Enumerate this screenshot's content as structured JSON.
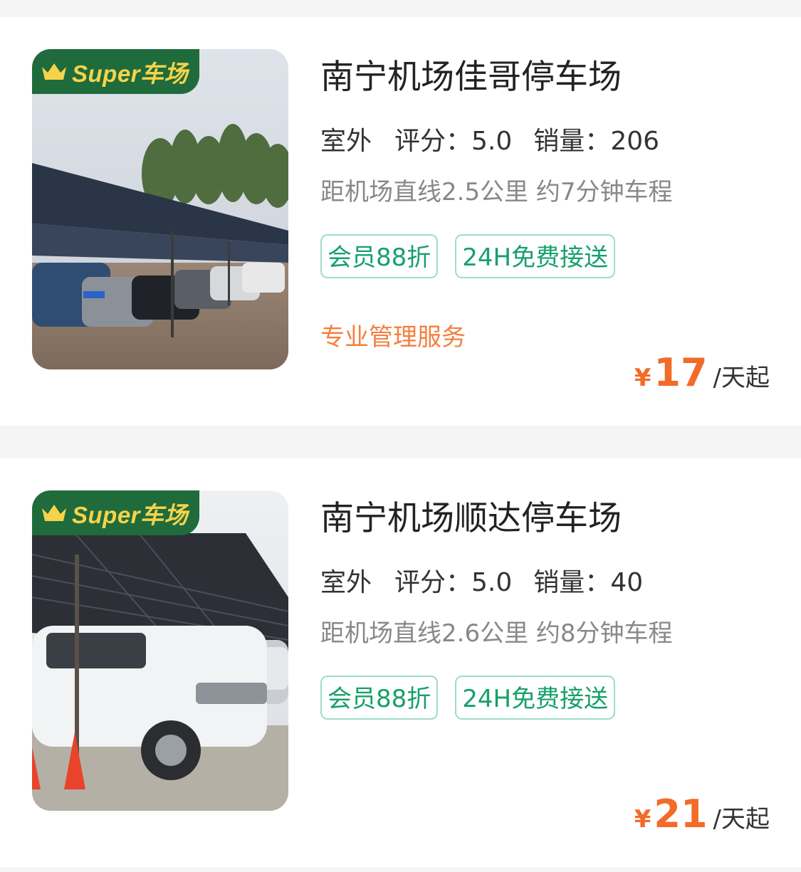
{
  "listings": [
    {
      "badge_text": "Super车场",
      "name": "南宁机场佳哥停车场",
      "type": "室外",
      "score_label": "评分：",
      "score": "5.0",
      "sales_label": "销量：",
      "sales": "206",
      "distance_text": "距机场直线2.5公里 约7分钟车程",
      "tags": [
        "会员88折",
        "24H免费接送"
      ],
      "service_text": "专业管理服务",
      "price_symbol": "¥",
      "price": "17",
      "price_unit": "/天起"
    },
    {
      "badge_text": "Super车场",
      "name": "南宁机场顺达停车场",
      "type": "室外",
      "score_label": "评分：",
      "score": "5.0",
      "sales_label": "销量：",
      "sales": "40",
      "distance_text": "距机场直线2.6公里 约8分钟车程",
      "tags": [
        "会员88折",
        "24H免费接送"
      ],
      "service_text": "",
      "price_symbol": "¥",
      "price": "21",
      "price_unit": "/天起"
    }
  ],
  "colors": {
    "badge_bg": "#1f6b3b",
    "badge_text": "#f6d34a",
    "tag_text": "#17a06c",
    "tag_border": "#9fdcc6",
    "price": "#f26b28",
    "service": "#f47f3e"
  }
}
